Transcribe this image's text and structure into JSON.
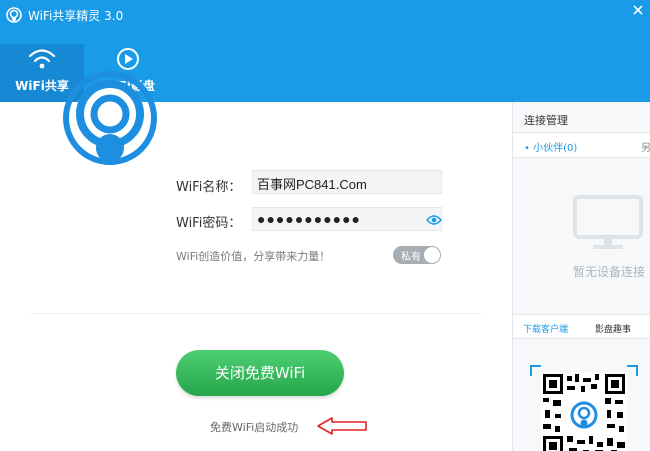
{
  "app": {
    "title": "WiFi共享精灵 3.0",
    "tabs": [
      {
        "label": "WiFi共享",
        "icon": "wifi-icon",
        "active": true
      },
      {
        "label": "WiFi影盘",
        "icon": "play-icon",
        "active": false
      }
    ]
  },
  "form": {
    "name_label": "WiFi名称：",
    "name_value": "百事网PC841.Com",
    "password_label": "WiFi密码：",
    "password_value": "●●●●●●●●●●●",
    "tagline": "WiFi创造价值，分享带来力量！",
    "privacy_toggle_label": "私有"
  },
  "action": {
    "button_label": "关闭免费WiFi",
    "status_text": "免费WiFi启动成功"
  },
  "right_panel": {
    "title": "连接管理",
    "tab_label": "• 小伙伴(0)",
    "tab_more": "另",
    "empty_text": "暂无设备连接",
    "link_download": "下载客户端",
    "link_movies": "影盘趣事"
  },
  "colors": {
    "header": "#1a9be8",
    "active_tab": "#1688d4",
    "button_green": "#2eb552",
    "arrow_red": "#e02020",
    "logo_blue": "#1e8fe0"
  }
}
